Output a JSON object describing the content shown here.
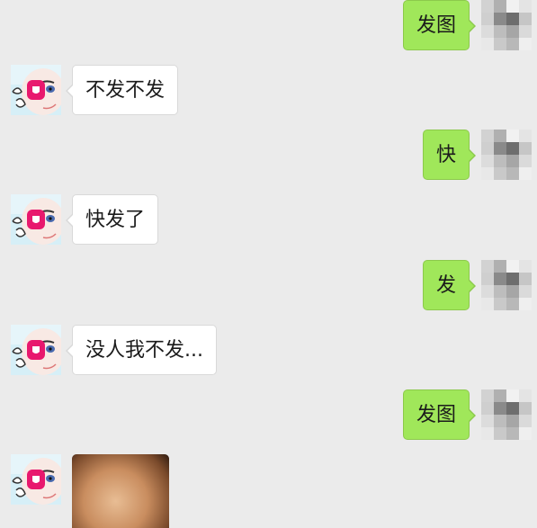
{
  "colors": {
    "background": "#ebebeb",
    "incoming_bubble": "#ffffff",
    "outgoing_bubble": "#a0e75a"
  },
  "messages": [
    {
      "side": "outgoing",
      "text": "发图",
      "avatar_icon": "pixelated-avatar-icon"
    },
    {
      "side": "incoming",
      "text": "不发不发",
      "avatar_icon": "cartoon-avatar-icon"
    },
    {
      "side": "outgoing",
      "text": "快",
      "avatar_icon": "pixelated-avatar-icon"
    },
    {
      "side": "incoming",
      "text": "快发了",
      "avatar_icon": "cartoon-avatar-icon"
    },
    {
      "side": "outgoing",
      "text": "发",
      "avatar_icon": "pixelated-avatar-icon"
    },
    {
      "side": "incoming",
      "text": "没人我不发...",
      "avatar_icon": "cartoon-avatar-icon"
    },
    {
      "side": "outgoing",
      "text": "发图",
      "avatar_icon": "pixelated-avatar-icon"
    },
    {
      "side": "incoming",
      "type": "image",
      "avatar_icon": "cartoon-avatar-icon"
    }
  ]
}
